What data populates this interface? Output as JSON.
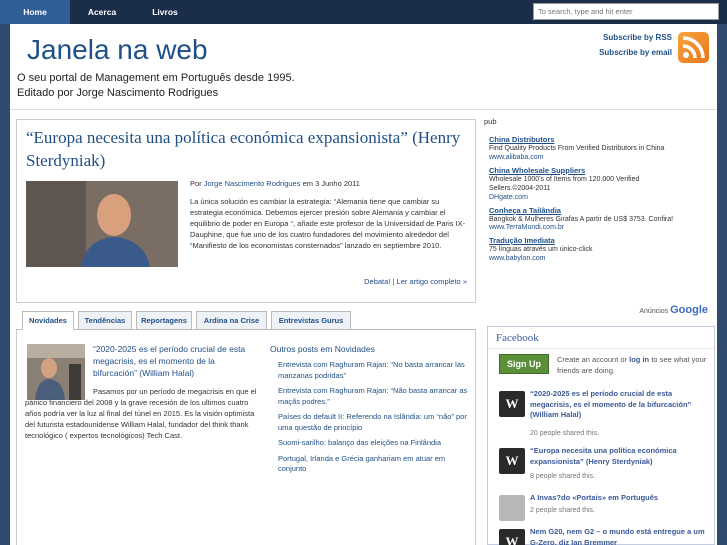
{
  "nav": {
    "tabs": [
      {
        "label": "Home"
      },
      {
        "label": "Acerca"
      },
      {
        "label": "Livros"
      }
    ],
    "search_placeholder": "To search, type and hit enter"
  },
  "header": {
    "title": "Janela na web",
    "tagline1": "O seu portal de Management em Português desde 1995.",
    "tagline2": "Editado por Jorge Nascimento Rodrigues",
    "subscribe_rss": "Subscribe by RSS",
    "subscribe_email": "Subscribe by email"
  },
  "article": {
    "title": "“Europa necesita una política económica expansionista” (Henry Sterdyniak)",
    "by_prefix": "Por",
    "author": "Jorge Nascimento Rodrigues",
    "date": "em 3 Junho 2011",
    "body": "La única solución es cambiar la estrategia: “Alemania tiene que cambiar su estrategia económica. Debemos ejercer presión sobre Alemania y cambiar el equilibrio de poder en Europa “, añade este profesor de la Universidad de Paris IX-Dauphine, que fue uno de los cuatro fundadores del movimiento alrededor del “Manifiesto de los economistas consternados” lanzado en septiembre 2010.",
    "link_debate": "Debata!",
    "link_sep": "|",
    "link_more": "Ler artigo completo »"
  },
  "tabs": [
    {
      "label": "Novidades"
    },
    {
      "label": "Tendências"
    },
    {
      "label": "Reportagens"
    },
    {
      "label": "Ardina na Crise"
    },
    {
      "label": "Entrevistas Gurus"
    }
  ],
  "featured": {
    "title": "“2020-2025 es el período crucial de esta megacrisis, es el momento de la bifurcación” (William Halal)",
    "text": "Pasamos por un período de megacrisis en que el pánico financiero del 2008 y la grave recesión de los ultimos cuatro años podría ver la luz al final del túnel en 2015. Es la visión optimista del futurista estadounidense William Halal, fundador del think thank tecnológico ( expertos tecnológicos) Tech Cast."
  },
  "outros": {
    "title": "Outros posts em Novidades",
    "items": [
      {
        "label": "Entrevista com Raghuram Rajan: “No basta arrancar las manzanas podridas”"
      },
      {
        "label": "Entrevista com Raghuram Rajan: “Não basta arrancar as maçãs podres.”"
      },
      {
        "label": "Países do default II: Referendo na Islândia: um “não” por uma questão de princípio"
      },
      {
        "label": "Suomi-sarilho: balanço das eleições na Finlândia"
      },
      {
        "label": "Portugal, Irlanda e Grécia ganhariam em atuar em conjunto"
      }
    ]
  },
  "ads": {
    "label": "pub",
    "items": [
      {
        "title": "China Distributors",
        "text": "Find Quality Products From Verified Distributors in China",
        "url": "www.alibaba.com"
      },
      {
        "title": "China Wholesale Suppliers",
        "text": "Wholesale 1000's of Items from 120.000 Verified Sellers.©2004-2011",
        "url": "DHgate.com"
      },
      {
        "title": "Conheça a Tailândia",
        "text": "Bangkok & Mulheres Girafas A partir de US$ 3753. Confira!",
        "url": "www.TerraMundi.com.br"
      },
      {
        "title": "Tradução Imediata",
        "text": "75 línguas através um único-click",
        "url": "www.babylon.com"
      }
    ],
    "by_label": "Anúncios",
    "by_brand": "Google"
  },
  "facebook": {
    "title": "Facebook",
    "signup": "Sign Up",
    "signup_text_1": "Create an account or",
    "signup_login": "log in",
    "signup_text_2": "to see what your friends are doing.",
    "items": [
      {
        "title": "“2020-2025 es el período crucial de esta megacrisis, es el momento de la bifurcación” (William Halal)",
        "count": "20 people shared this."
      },
      {
        "title": "“Europa necesita una política económica expansionista” (Henry Sterdyniak)",
        "count": "8 people shared this."
      },
      {
        "title": "A Invas?do «Portais» em Português",
        "count": "2 people shared this."
      },
      {
        "title": "Nem G20, nem G2 – o mundo está entregue a um G-Zero, diz Ian Bremmer",
        "count": ""
      }
    ]
  },
  "colors": {
    "background": "#2f4a6e",
    "nav": "#1a2e4a",
    "link": "#1f4f87",
    "facebook": "#3b5998",
    "signup": "#5b8f3a",
    "rss": "#e8751a"
  }
}
